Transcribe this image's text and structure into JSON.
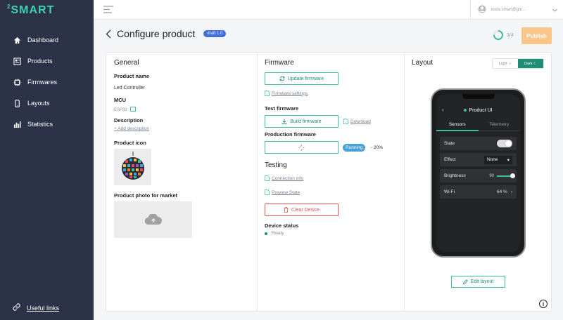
{
  "app": {
    "logo_sup": "2",
    "logo_text": "SMART"
  },
  "sidebar": {
    "items": [
      {
        "label": "Dashboard",
        "icon": "home-icon"
      },
      {
        "label": "Products",
        "icon": "products-icon"
      },
      {
        "label": "Firmwares",
        "icon": "firmware-icon"
      },
      {
        "label": "Layouts",
        "icon": "phone-icon"
      },
      {
        "label": "Statistics",
        "icon": "bar-chart-icon"
      }
    ],
    "useful_links": "Useful links"
  },
  "topbar": {
    "email": "koda.smart@gm..."
  },
  "header": {
    "title": "Configure product",
    "badge": "draft 1.0",
    "progress": "3/4",
    "progress_fraction": 0.75,
    "publish": "Publish"
  },
  "general": {
    "heading": "General",
    "product_name_label": "Product name",
    "product_name": "Led Controller",
    "mcu_label": "MCU",
    "mcu": "ESP32",
    "description_label": "Description",
    "add_description": "+ Add description",
    "icon_label": "Product icon",
    "photo_label": "Product photo for market"
  },
  "firmware": {
    "heading": "Firmware",
    "update": "Update firmware",
    "settings": "Firmware settings",
    "test_label": "Test firmware",
    "build": "Build firmware",
    "download": "Download",
    "production_label": "Production firmware",
    "status_pill": "Running",
    "percent": "- 20%"
  },
  "testing": {
    "heading": "Testing",
    "connection": "Connection info",
    "preview": "Preview State",
    "clear": "Clear Device",
    "status_label": "Device status",
    "status": "Ready"
  },
  "layout": {
    "heading": "Layout",
    "theme_light": "Light",
    "theme_dark": "Dark",
    "edit": "Edit layout"
  },
  "phone": {
    "title": "Product UI",
    "tabs": [
      "Sensors",
      "Telemetry"
    ],
    "state_label": "State",
    "effect_label": "Effect",
    "effect_value": "None",
    "brightness_label": "Brightness",
    "brightness_value": "90",
    "wifi_label": "Wi-Fi",
    "wifi_value": "64 %"
  },
  "colors": {
    "sidebar": "#2c3348",
    "accent": "#3dbfa4",
    "publish": "#f9c588",
    "badge": "#3e6de3"
  }
}
